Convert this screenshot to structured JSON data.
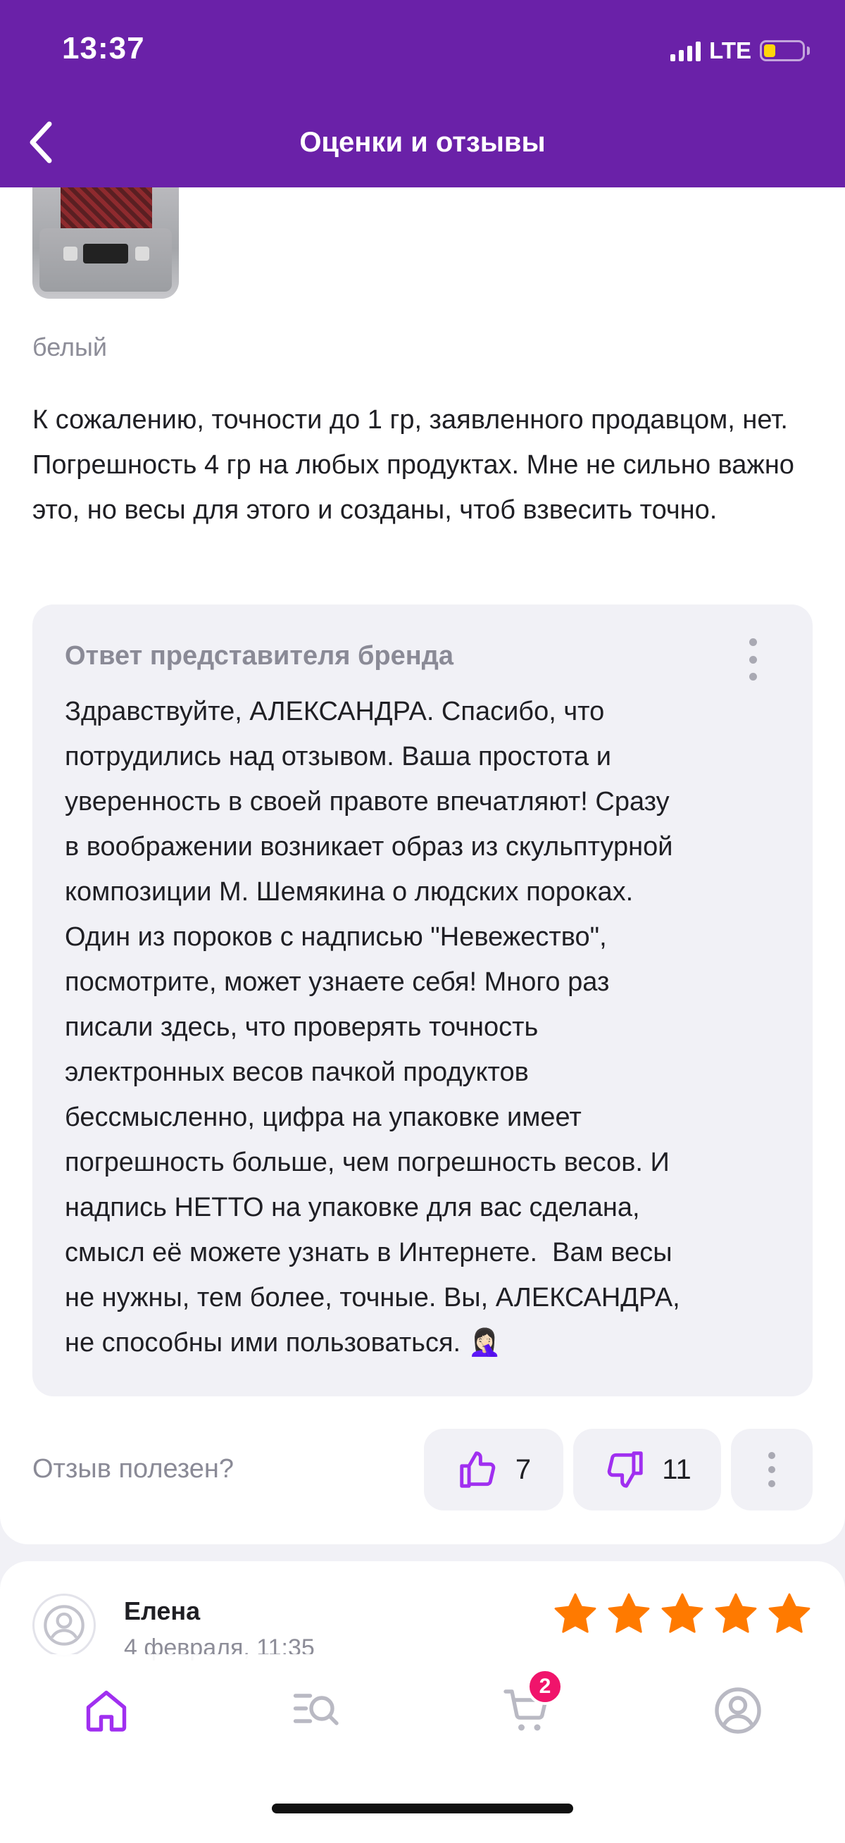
{
  "status_bar": {
    "time": "13:37",
    "network": "LTE",
    "battery_level": 0.2
  },
  "header": {
    "title": "Оценки и отзывы",
    "back_icon": "chevron-left-icon"
  },
  "review": {
    "variant": "белый",
    "text": "К сожалению, точности до 1 гр, заявленного продавцом, нет. Погрешность 4 гр на любых продуктах. Мне не сильно важно это, но весы для этого и созданы, чтоб взвесить точно.",
    "brand_reply": {
      "title": "Ответ представителя бренда",
      "lines": [
        "Здравствуйте, АЛЕКСАНДРА. Спасибо, что",
        "потрудились над отзывом. Ваша простота и",
        "уверенность в своей правоте впечатляют! Сразу",
        "в воображении возникает образ из скульптурной",
        "композиции М. Шемякина о людских пороках.",
        "Один из пороков с надписью \"Невежество\",",
        "посмотрите, может узнаете себя! Много раз",
        "писали здесь, что проверять точность",
        "электронных весов пачкой продуктов",
        "бессмысленно, цифра на упаковке имеет",
        "погрешность больше, чем погрешность весов. И",
        "надпись НЕТТО на упаковке для вас сделана,",
        "смысл её можете узнать в Интернете.  Вам весы",
        "не нужны, тем более, точные. Вы, АЛЕКСАНДРА,",
        "не способны ими пользоваться. 🤦🏻‍♀️"
      ]
    },
    "helpful_label": "Отзыв полезен?",
    "likes": "7",
    "dislikes": "11"
  },
  "next_review": {
    "author": "Елена",
    "date": "4 февраля, 11:35",
    "rating": 5
  },
  "tabbar": {
    "items": [
      "home-icon",
      "catalog-search-icon",
      "cart-icon",
      "profile-icon"
    ],
    "cart_badge": "2"
  },
  "colors": {
    "brand": "#6a21a8",
    "accent": "#a02ff0",
    "star": "#ff7a00",
    "badge": "#f0146b"
  }
}
